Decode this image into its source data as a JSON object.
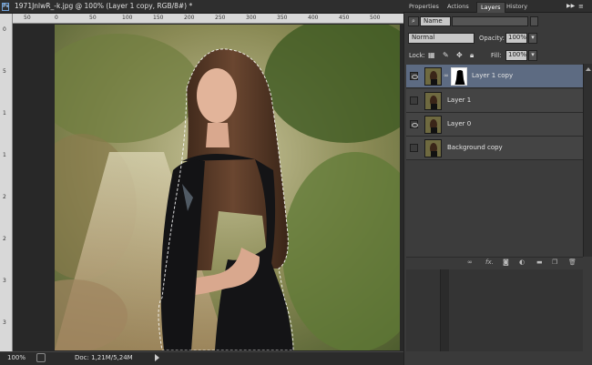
{
  "document": {
    "badge": "Ps",
    "title": "1971JnlwR_-k.jpg @ 100% (Layer 1 copy, RGB/8#) *"
  },
  "ruler_top_labels": [
    "50",
    "0",
    "50",
    "100",
    "150",
    "200",
    "250",
    "300",
    "350",
    "400",
    "450",
    "500"
  ],
  "ruler_left_labels": [
    "0",
    "5",
    "1",
    "1",
    "2",
    "2",
    "3",
    "3"
  ],
  "statusbar": {
    "zoom": "100%",
    "docinfo": "Doc: 1,21M/5,24M"
  },
  "panel": {
    "tabs": [
      "Properties",
      "Actions",
      "Layers",
      "History"
    ],
    "active_tab": "Layers",
    "filter_kind": "Name",
    "blend_mode": "Normal",
    "opacity_label": "Opacity:",
    "opacity_value": "100%",
    "lock_label": "Lock:",
    "fill_label": "Fill:",
    "fill_value": "100%"
  },
  "layers": [
    {
      "name": "Layer 1 copy",
      "visible": true,
      "selected": true,
      "has_mask": true
    },
    {
      "name": "Layer 1",
      "visible": false,
      "selected": false,
      "has_mask": false
    },
    {
      "name": "Layer 0",
      "visible": true,
      "selected": false,
      "has_mask": false
    },
    {
      "name": "Background copy",
      "visible": false,
      "selected": false,
      "has_mask": false
    }
  ],
  "layer_bottom_icons": [
    "link-layers-icon",
    "fx-icon",
    "add-mask-icon",
    "adjustment-icon",
    "group-icon",
    "new-layer-icon",
    "trash-icon"
  ],
  "colors": {
    "selected_layer": "#5d6b82",
    "panel_bg": "#3a3a3a",
    "workspace_bg": "#282828",
    "ps_badge": "#6fa0d8"
  }
}
